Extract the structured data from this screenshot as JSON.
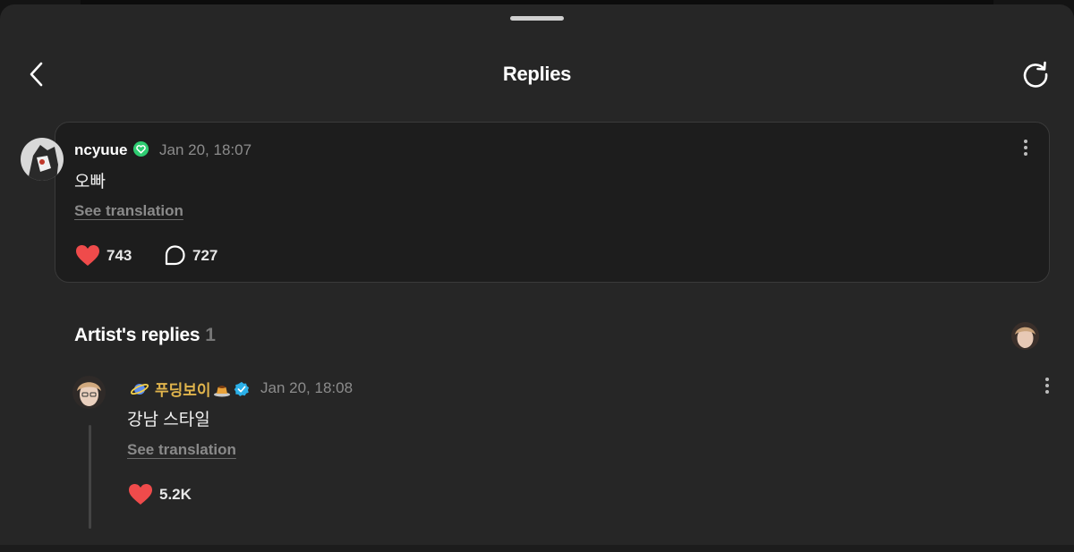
{
  "header": {
    "title": "Replies"
  },
  "comment": {
    "username": "ncyuue",
    "timestamp": "Jan 20, 18:07",
    "text": "오빠",
    "see_translation": "See translation",
    "likes": "743",
    "replies": "727"
  },
  "artist_section": {
    "title": "Artist's replies",
    "count": "1"
  },
  "reply": {
    "username": "푸딩보이",
    "timestamp": "Jan 20, 18:08",
    "text": "강남 스타일",
    "see_translation": "See translation",
    "likes": "5.2K"
  },
  "colors": {
    "background": "#262626",
    "card": "#1d1d1d",
    "heart": "#ef4b4b",
    "verified_green": "#2ecc71",
    "verified_blue": "#2bb0e8",
    "artist_name": "#e0b44c"
  },
  "icons": [
    "back-arrow-icon",
    "refresh-icon",
    "heart-icon",
    "comment-bubble-icon",
    "more-vertical-icon",
    "verified-badge-icon",
    "planet-emoji-icon",
    "pudding-emoji-icon"
  ]
}
